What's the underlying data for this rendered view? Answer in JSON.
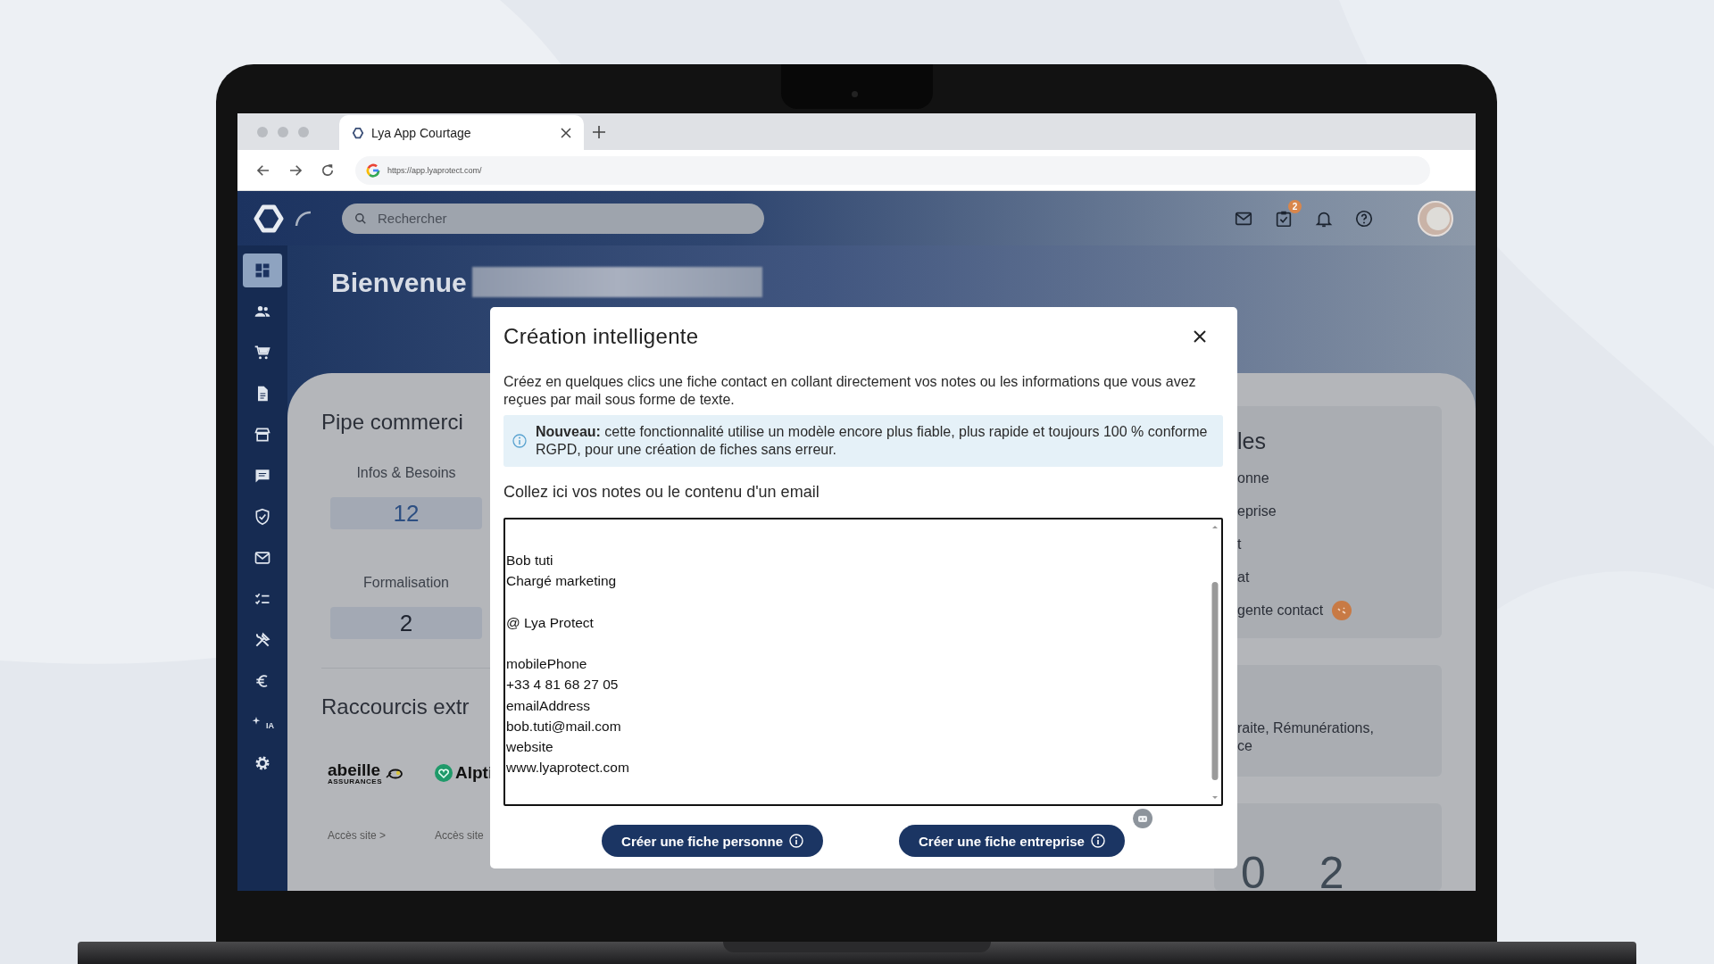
{
  "browser": {
    "tab_title": "Lya App Courtage",
    "url": "https://app.lyaprotect.com/"
  },
  "header": {
    "search": {
      "placeholder": "Rechercher"
    },
    "tasks_badge": "2"
  },
  "sidebar": {
    "items": [
      {
        "kind": "dashboard",
        "selected": true
      },
      {
        "kind": "people",
        "selected": false
      },
      {
        "kind": "cart",
        "selected": false
      },
      {
        "kind": "document",
        "selected": false
      },
      {
        "kind": "store",
        "selected": false
      },
      {
        "kind": "chat",
        "selected": false
      },
      {
        "kind": "shield",
        "selected": false
      },
      {
        "kind": "mail",
        "selected": false
      },
      {
        "kind": "checklist",
        "selected": false
      },
      {
        "kind": "tools",
        "selected": false
      },
      {
        "kind": "euro",
        "selected": false
      },
      {
        "kind": "ai",
        "label": "IA",
        "selected": false
      },
      {
        "kind": "gear",
        "selected": false
      }
    ]
  },
  "welcome": {
    "title": "Bienvenue"
  },
  "pipeline": {
    "title": "Pipe commerci",
    "stages": [
      {
        "label": "Infos & Besoins",
        "count": "12",
        "color": "#2d4f82"
      },
      {
        "label": "Formalisation",
        "count": "2",
        "color": "#1f2430"
      }
    ]
  },
  "shortcuts": {
    "title": "Raccourcis extr",
    "partners": [
      {
        "kind": "bee",
        "name": "abeille",
        "sub": "ASSURANCES",
        "link": "Accès site >"
      },
      {
        "kind": "heart",
        "name": "Alpti",
        "link": "Accès site"
      }
    ]
  },
  "right_panel": {
    "title": "les",
    "items": [
      {
        "label": "onne",
        "badge": false
      },
      {
        "label": "eprise",
        "badge": false
      },
      {
        "label": "t",
        "badge": false
      },
      {
        "label": "at",
        "badge": false
      },
      {
        "label": "gente contact",
        "badge": true
      }
    ]
  },
  "right_card": {
    "lines": [
      "raite, Rémunérations,",
      "ce"
    ]
  },
  "stats": [
    {
      "value": "0",
      "color": "#3f4a55"
    },
    {
      "value": "2",
      "color": "#3f4a55"
    }
  ],
  "modal": {
    "title": "Création intelligente",
    "description": "Créez en quelques clics une fiche contact en collant directement vos notes ou les informations que vous avez reçues par mail sous forme de texte.",
    "notice": "**Nouveau:** cette fonctionnalité utilise un modèle encore plus fiable, plus rapide et toujours 100 % conforme RGPD, pour une création de fiches sans erreur.",
    "field_label": "Collez ici vos notes ou le contenu d'un email",
    "notes": {
      "value": "\nBob tuti\nChargé marketing\n\n@ Lya Protect\n\nmobilePhone\n+33 4 81 68 27 05\nemailAddress\nbob.tuti@mail.com\nwebsite\nwww.lyaprotect.com"
    },
    "buttons": [
      {
        "label": "Créer une fiche personne"
      },
      {
        "label": "Créer une fiche entreprise"
      }
    ]
  }
}
